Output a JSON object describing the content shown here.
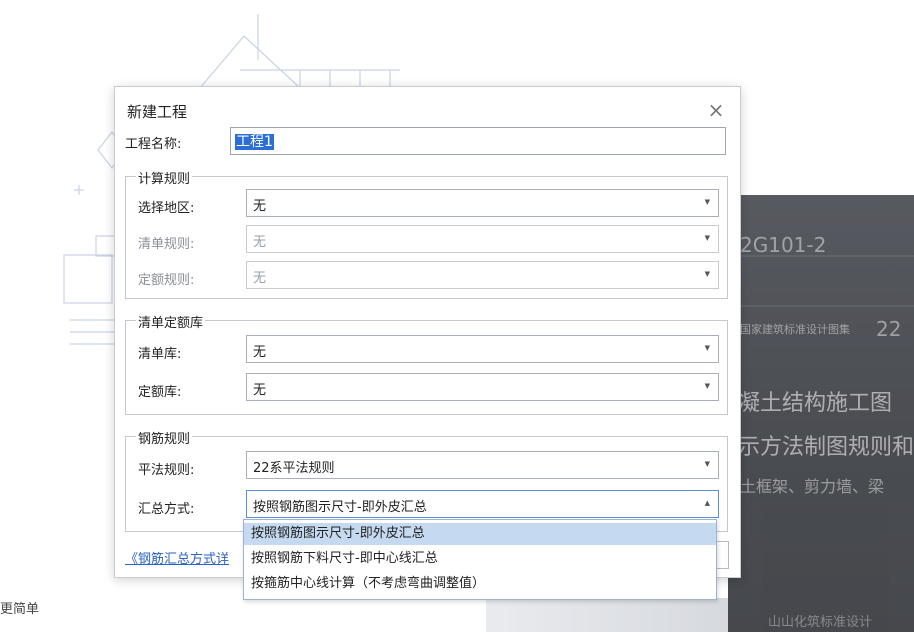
{
  "background": {
    "book_texts": [
      "2G101-2",
      "国家建筑标准设计图集",
      "22",
      "凝土结构施工图",
      "示方法制图规则和",
      "土框架、剪力墙、梁",
      "山山化筑标准设计"
    ],
    "footer_text": "更简单"
  },
  "dialog": {
    "title": "新建工程",
    "close_icon": "close-icon",
    "project_name_label": "工程名称:",
    "project_name_value": "工程1",
    "calc_rules": {
      "title": "计算规则",
      "region_label": "选择地区:",
      "region_value": "无",
      "bill_rule_label": "清单规则:",
      "bill_rule_value": "无",
      "quota_rule_label": "定额规则:",
      "quota_rule_value": "无"
    },
    "bill_quota_lib": {
      "title": "清单定额库",
      "bill_lib_label": "清单库:",
      "bill_lib_value": "无",
      "quota_lib_label": "定额库:",
      "quota_lib_value": "无"
    },
    "rebar_rules": {
      "title": "钢筋规则",
      "pingfa_label": "平法规则:",
      "pingfa_value": "22系平法规则",
      "summary_label": "汇总方式:",
      "summary_value": "按照钢筋图示尺寸-即外皮汇总"
    },
    "link_text": "《钢筋汇总方式详"
  },
  "dropdown": {
    "options": [
      "按照钢筋图示尺寸-即外皮汇总",
      "按照钢筋下料尺寸-即中心线汇总",
      "按箍筋中心线计算（不考虑弯曲调整值）"
    ],
    "selected_index": 0
  },
  "colors": {
    "selection_highlight": "#c5d9f1",
    "text_selection": "#2b6fd6",
    "link": "#2b63c8"
  }
}
